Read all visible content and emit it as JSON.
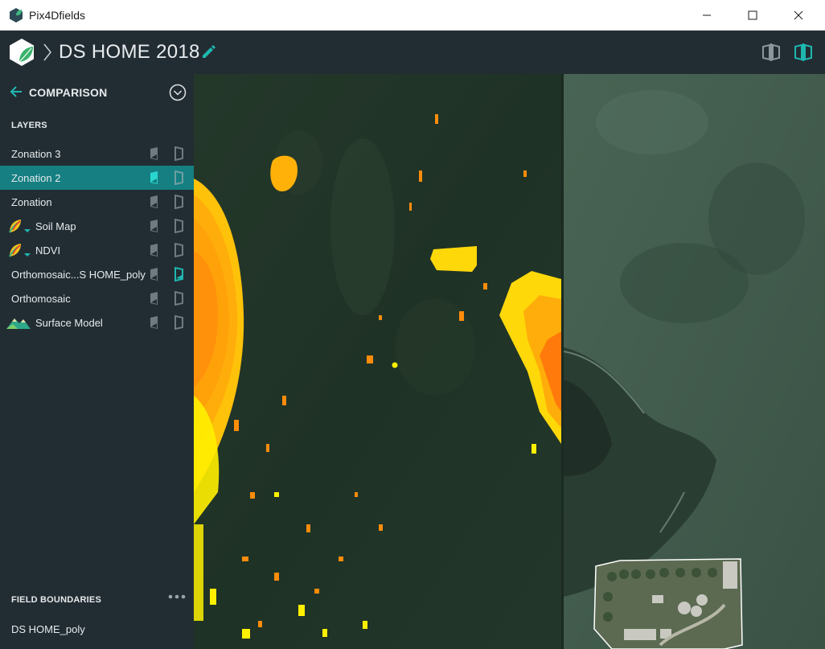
{
  "window": {
    "title": "Pix4Dfields",
    "minimize_icon": "minimize-icon",
    "maximize_icon": "maximize-icon",
    "close_icon": "close-icon"
  },
  "header": {
    "project_title": "DS HOME 2018",
    "logo_icon": "pix4d-logo",
    "edit_icon": "pencil-icon",
    "view_single_icon": "split-view-icon",
    "view_split_icon": "split-view-active-icon"
  },
  "sidebar": {
    "title": "COMPARISON",
    "back_icon": "arrow-left-icon",
    "toggle_icon": "chevron-down-circle-icon",
    "layers_label": "LAYERS",
    "layers": [
      {
        "label": "Zonation 3",
        "icon": null,
        "left_active": false,
        "right_active": false
      },
      {
        "label": "Zonation 2",
        "icon": null,
        "left_active": true,
        "right_active": false,
        "selected": true
      },
      {
        "label": "Zonation",
        "icon": null,
        "left_active": false,
        "right_active": false
      },
      {
        "label": "Soil Map",
        "icon": "leaf-icon",
        "left_active": false,
        "right_active": false
      },
      {
        "label": "NDVI",
        "icon": "leaf-icon",
        "left_active": false,
        "right_active": false
      },
      {
        "label": "Orthomosaic...S HOME_poly",
        "icon": null,
        "left_active": false,
        "right_active": true
      },
      {
        "label": "Orthomosaic",
        "icon": null,
        "left_active": false,
        "right_active": false
      },
      {
        "label": "Surface Model",
        "icon": "mountain-icon",
        "left_active": false,
        "right_active": false
      }
    ],
    "field_boundaries_label": "FIELD BOUNDARIES",
    "field_boundaries": [
      "DS HOME_poly"
    ]
  },
  "colors": {
    "accent": "#19b5b5",
    "selected_row": "#157f82",
    "panel_bg": "#222d33",
    "zone_orange": "#ff7a0a",
    "zone_amber": "#ffad0a",
    "zone_yellow": "#fff000"
  }
}
